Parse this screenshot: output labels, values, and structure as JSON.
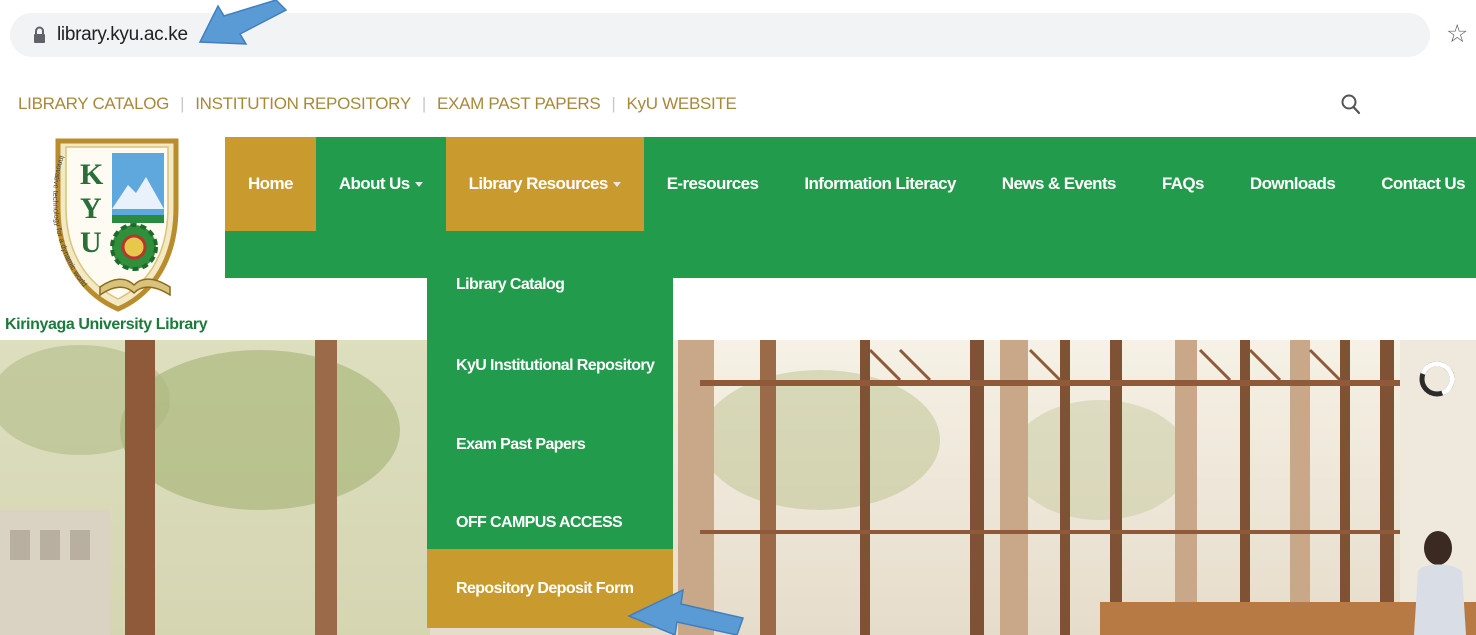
{
  "browser": {
    "url": "library.kyu.ac.ke"
  },
  "topnav": {
    "links": [
      "LIBRARY CATALOG",
      "INSTITUTION REPOSITORY",
      "EXAM PAST PAPERS",
      "KyU WEBSITE"
    ],
    "separator": "|"
  },
  "header": {
    "site_name": "Kirinyaga University Library",
    "logo": {
      "letters": [
        "K",
        "Y",
        "U"
      ],
      "motto": "Innovative technology for a dynamic world"
    }
  },
  "menu": {
    "items": [
      {
        "label": "Home",
        "active": true,
        "has_dropdown": false
      },
      {
        "label": "About Us",
        "active": false,
        "has_dropdown": true
      },
      {
        "label": "Library Resources",
        "active": true,
        "has_dropdown": true
      },
      {
        "label": "E-resources",
        "active": false,
        "has_dropdown": false
      },
      {
        "label": "Information Literacy",
        "active": false,
        "has_dropdown": false
      },
      {
        "label": "News & Events",
        "active": false,
        "has_dropdown": false
      },
      {
        "label": "FAQs",
        "active": false,
        "has_dropdown": false
      },
      {
        "label": "Downloads",
        "active": false,
        "has_dropdown": false
      },
      {
        "label": "Contact Us",
        "active": false,
        "has_dropdown": false
      }
    ]
  },
  "dropdown": {
    "items": [
      {
        "label": "Library Catalog",
        "highlighted": false
      },
      {
        "label": "KyU Institutional Repository",
        "highlighted": false
      },
      {
        "label": "Exam Past Papers",
        "highlighted": false
      },
      {
        "label": "OFF CAMPUS ACCESS",
        "highlighted": false
      },
      {
        "label": "Repository Deposit Form",
        "highlighted": true
      }
    ]
  },
  "colors": {
    "green": "#239b4d",
    "gold": "#c99a2e",
    "topnav_text": "#a8893a",
    "annotation_arrow": "#5b9bd5"
  },
  "icons": {
    "lock": "lock-icon",
    "star": "star-icon",
    "search": "search-icon",
    "loader": "loader-icon",
    "caret": "caret-down-icon"
  }
}
